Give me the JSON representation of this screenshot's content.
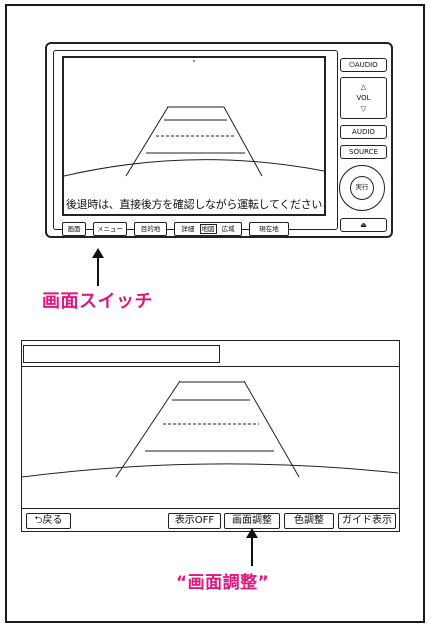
{
  "unit": {
    "screen_message": "後退時は、直接後方を確認しながら運転してください",
    "bottom_buttons": [
      "画面",
      "メニュー",
      "目的地",
      "詳細",
      "地図",
      "広域",
      "現在地"
    ],
    "side_buttons": {
      "power_audio": "⏻AUDIO",
      "vol_up": "△",
      "vol": "VOL",
      "vol_down": "▽",
      "audio": "AUDIO",
      "source": "SOURCE",
      "enter": "実行",
      "eject": "⏏"
    }
  },
  "callout1": "画面スイッチ",
  "screen2": {
    "buttons": {
      "back": "戻る",
      "display_off": "表示OFF",
      "screen_adjust": "画面調整",
      "color_adjust": "色調整",
      "guide_display": "ガイド表示"
    }
  },
  "callout2": "“画面調整”"
}
